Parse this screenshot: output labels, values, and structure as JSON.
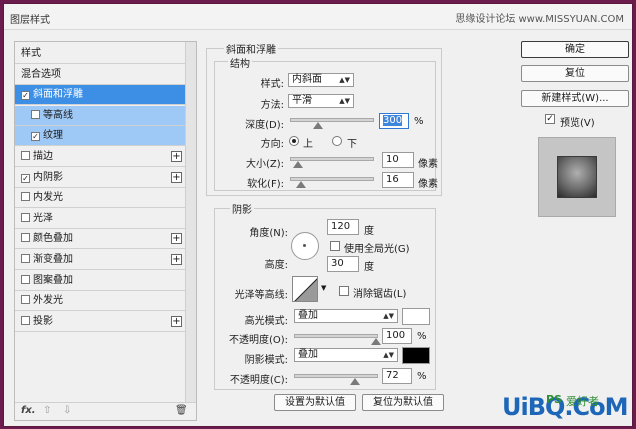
{
  "window": {
    "title": "图层样式",
    "watermark": "思缘设计论坛 www.MISSYUAN.COM"
  },
  "sidebar": {
    "items": [
      {
        "label": "样式",
        "check": null,
        "plus": false,
        "state": "normal"
      },
      {
        "label": "混合选项",
        "check": null,
        "plus": false,
        "state": "normal"
      },
      {
        "label": "斜面和浮雕",
        "check": "✓",
        "plus": false,
        "state": "selected"
      },
      {
        "label": "等高线",
        "check": "",
        "plus": false,
        "state": "sub"
      },
      {
        "label": "纹理",
        "check": "✓",
        "plus": false,
        "state": "sub"
      },
      {
        "label": "描边",
        "check": "",
        "plus": true,
        "state": "normal"
      },
      {
        "label": "内阴影",
        "check": "✓",
        "plus": true,
        "state": "normal"
      },
      {
        "label": "内发光",
        "check": "",
        "plus": false,
        "state": "normal"
      },
      {
        "label": "光泽",
        "check": "",
        "plus": false,
        "state": "normal"
      },
      {
        "label": "颜色叠加",
        "check": "",
        "plus": true,
        "state": "normal"
      },
      {
        "label": "渐变叠加",
        "check": "",
        "plus": true,
        "state": "normal"
      },
      {
        "label": "图案叠加",
        "check": "",
        "plus": false,
        "state": "normal"
      },
      {
        "label": "外发光",
        "check": "",
        "plus": false,
        "state": "normal"
      },
      {
        "label": "投影",
        "check": "",
        "plus": true,
        "state": "normal"
      }
    ],
    "fx": "fx.",
    "up_icon": "⇧",
    "down_icon": "⇩",
    "trash_icon": "🗑"
  },
  "bevel": {
    "section_title": "斜面和浮雕",
    "structure_title": "结构",
    "style_label": "样式:",
    "style_value": "内斜面",
    "technique_label": "方法:",
    "technique_value": "平滑",
    "depth_label": "深度(D):",
    "depth_value": "300",
    "depth_unit": "%",
    "depth_level": 0.35,
    "direction_label": "方向:",
    "direction_up": "上",
    "direction_down": "下",
    "size_label": "大小(Z):",
    "size_value": "10",
    "size_unit": "像素",
    "size_level": 0.04,
    "soften_label": "软化(F):",
    "soften_value": "16",
    "soften_unit": "像素",
    "soften_level": 0.1
  },
  "shading": {
    "title": "阴影",
    "angle_label": "角度(N):",
    "angle_value": "120",
    "angle_unit": "度",
    "global_light_label": "使用全局光(G)",
    "altitude_label": "高度:",
    "altitude_value": "30",
    "altitude_unit": "度",
    "gloss_label": "光泽等高线:",
    "anti_alias_label": "消除锯齿(L)",
    "highlight_mode_label": "高光模式:",
    "highlight_mode_value": "叠加",
    "highlight_color": "#ffffff",
    "highlight_opacity_label": "不透明度(O):",
    "highlight_opacity_value": "100",
    "highlight_opacity_level": 1.0,
    "shadow_mode_label": "阴影模式:",
    "shadow_mode_value": "叠加",
    "shadow_color": "#000000",
    "shadow_opacity_label": "不透明度(C):",
    "shadow_opacity_value": "72",
    "shadow_opacity_level": 0.72,
    "percent": "%"
  },
  "actions": {
    "make_default": "设置为默认值",
    "reset_default": "复位为默认值",
    "ok": "确定",
    "reset": "复位",
    "new_style": "新建样式(W)...",
    "preview_label": "预览(V)"
  },
  "logo": {
    "main": "UiBQ.CoM",
    "ps": "PS",
    "site": "爱好者"
  }
}
